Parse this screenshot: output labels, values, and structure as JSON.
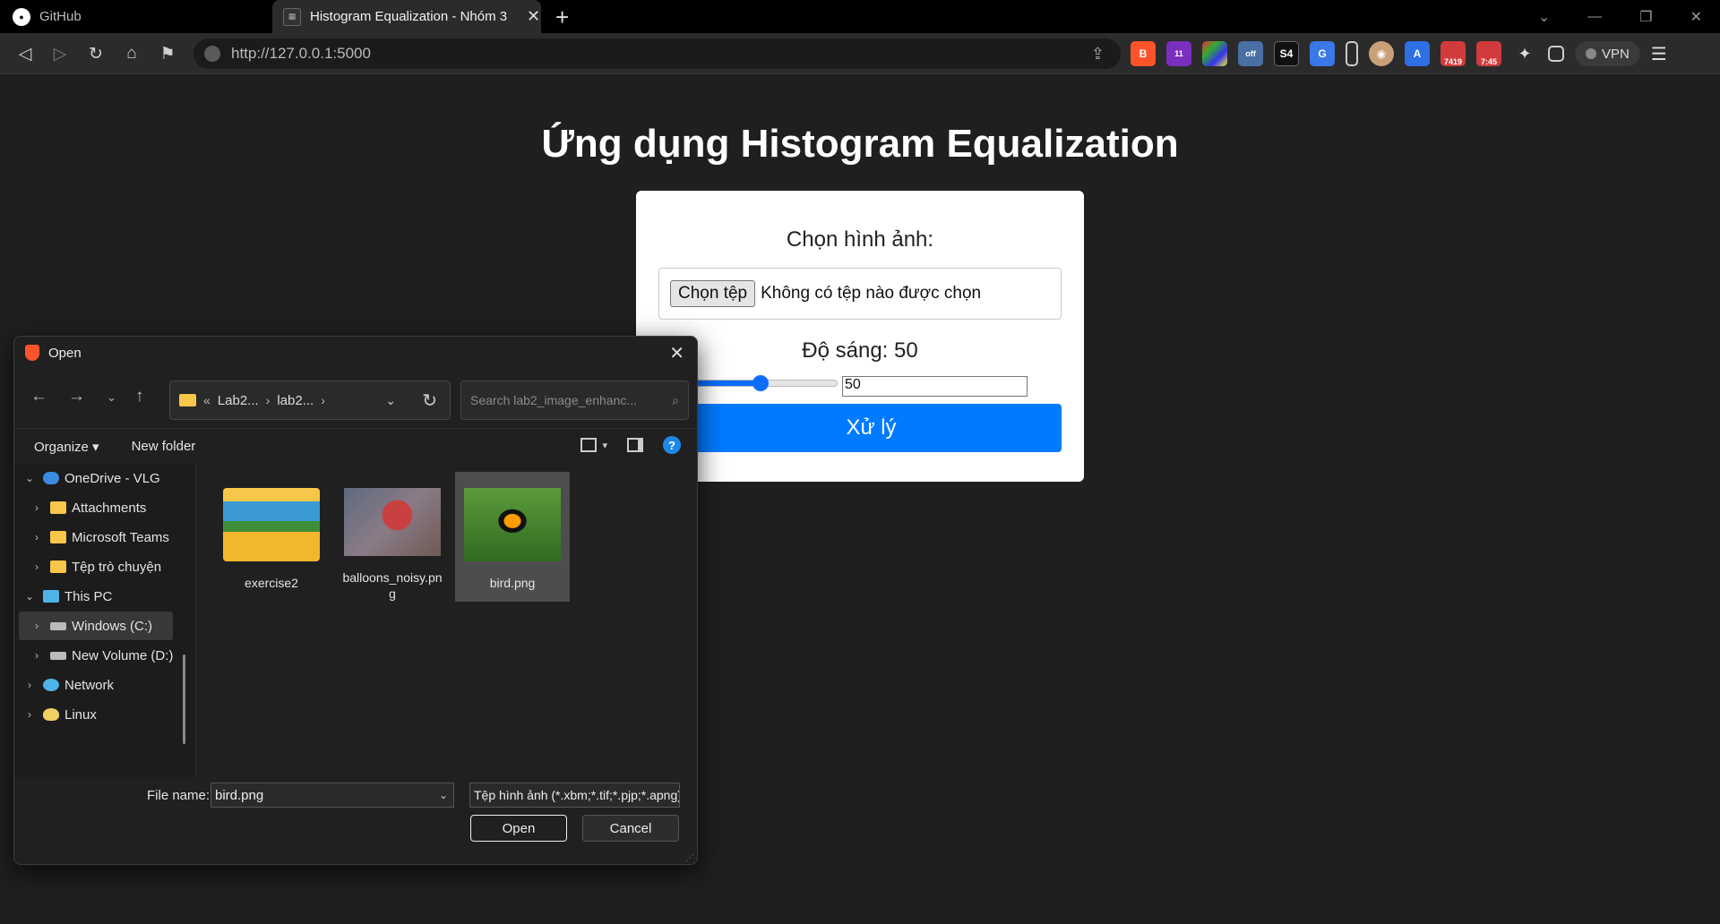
{
  "browser": {
    "tabs": [
      {
        "title": "GitHub",
        "active": false
      },
      {
        "title": "Histogram Equalization - Nhóm 3",
        "active": true
      }
    ],
    "url": "http://127.0.0.1:5000",
    "extensions": [
      "brave-rewards-icon",
      "brave-news-icon",
      "colorzilla-icon",
      "ghostery-icon",
      "s4-icon",
      "translate-icon",
      "mobile-icon",
      "owl-icon",
      "spellcheck-icon",
      "mail-icon",
      "calendar-icon",
      "extensions-icon",
      "sidebar-icon"
    ],
    "badges": {
      "alerts": "11",
      "mail": "7419",
      "calendar": "7:45",
      "ghostery": "off"
    },
    "vpn_label": "VPN"
  },
  "page": {
    "title": "Ứng dụng Histogram Equalization",
    "choose_label": "Chọn hình ảnh:",
    "file_button": "Chọn tệp",
    "file_status": "Không có tệp nào được chọn",
    "brightness_label": "Độ sáng: 50",
    "brightness_value": "50",
    "brightness_fraction": 0.5,
    "submit": "Xử lý"
  },
  "dialog": {
    "title": "Open",
    "breadcrumb": [
      "«",
      "Lab2...",
      "lab2..."
    ],
    "search_placeholder": "Search lab2_image_enhanc...",
    "organize": "Organize",
    "new_folder": "New folder",
    "tree": [
      {
        "label": "OneDrive - VLG",
        "icon": "cloud-icon",
        "level": 0,
        "expanded": true
      },
      {
        "label": "Attachments",
        "icon": "folder-icon",
        "level": 1
      },
      {
        "label": "Microsoft Teams",
        "icon": "folder-icon",
        "level": 1
      },
      {
        "label": "Tệp trò chuyện",
        "icon": "folder-icon",
        "level": 1
      },
      {
        "label": "This PC",
        "icon": "pc-icon",
        "level": 0,
        "expanded": true
      },
      {
        "label": "Windows (C:)",
        "icon": "drive-icon",
        "level": 1,
        "selected": true
      },
      {
        "label": "New Volume (D:)",
        "icon": "drive-icon",
        "level": 1
      },
      {
        "label": "Network",
        "icon": "network-icon",
        "level": 0
      },
      {
        "label": "Linux",
        "icon": "linux-icon",
        "level": 0
      }
    ],
    "files": [
      {
        "name": "exercise2",
        "kind": "folder"
      },
      {
        "name": "balloons_noisy.png",
        "kind": "image"
      },
      {
        "name": "bird.png",
        "kind": "image",
        "selected": true
      }
    ],
    "file_name_label": "File name:",
    "file_name_value": "bird.png",
    "file_type": "Tệp hình ảnh (*.xbm;*.tif;*.pjp;*.apng)",
    "open_button": "Open",
    "cancel_button": "Cancel"
  }
}
